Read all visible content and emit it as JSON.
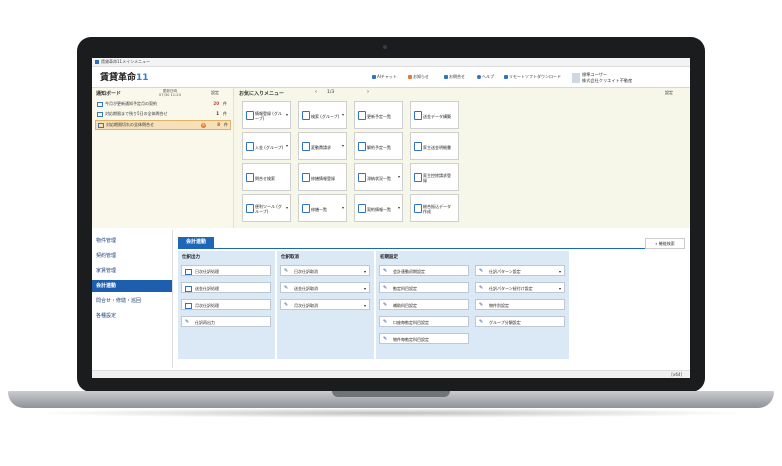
{
  "window": {
    "title": "賃貸革命11メインメニュー"
  },
  "app": {
    "logo_text": "賃貸革命",
    "logo_version": "11"
  },
  "header_buttons": [
    "AIチャット",
    "お知らせ",
    "お問合せ",
    "ヘルプ",
    "リモートソフトダウンロード"
  ],
  "user": {
    "name": "標準ユーザー",
    "company": "株式会社クリエイト不動産"
  },
  "notice_board": {
    "title": "通知ボード",
    "updated_label": "更新日時",
    "updated_time": "07/30 11:24",
    "settings_label": "設定",
    "rows": [
      {
        "label": "今月が更新通知予定月の契約",
        "count": "20",
        "unit": "件"
      },
      {
        "label": "対応期限まで残り5日の全体問合せ",
        "count": "1",
        "unit": "件"
      },
      {
        "label": "対応期限切れの全体問合せ",
        "count": "8",
        "unit": "件",
        "badge": "8"
      }
    ]
  },
  "favorites": {
    "title": "お気に入りメニュー",
    "page": "1/3",
    "settings_label": "設定",
    "tiles": [
      {
        "label": "情報登録 (グループ)",
        "dropdown": true
      },
      {
        "label": "検索 (グループ)",
        "dropdown": true
      },
      {
        "label": "更新予定一覧",
        "dropdown": false
      },
      {
        "label": "送金データ構築",
        "dropdown": false
      },
      {
        "label": "入金 (グループ)",
        "dropdown": true
      },
      {
        "label": "変動費請求",
        "dropdown": true
      },
      {
        "label": "解約予定一覧",
        "dropdown": false
      },
      {
        "label": "家主送金明細書",
        "dropdown": false
      },
      {
        "label": "問合せ検索",
        "dropdown": false
      },
      {
        "label": "修繕情報登録",
        "dropdown": false
      },
      {
        "label": "滞納状況一覧",
        "dropdown": true
      },
      {
        "label": "家主控除請求登録",
        "dropdown": false
      },
      {
        "label": "便利ツール (グループ)",
        "dropdown": true
      },
      {
        "label": "修繕一覧",
        "dropdown": true
      },
      {
        "label": "契約情報一覧",
        "dropdown": true
      },
      {
        "label": "総合振込データ作成",
        "dropdown": false
      }
    ]
  },
  "sidebar": {
    "items": [
      "物件管理",
      "契約管理",
      "家賃管理",
      "会計連動",
      "問合せ・修繕・巡回",
      "各種設定"
    ],
    "active_index": 3
  },
  "main": {
    "tab_label": "会計連動",
    "function_search": "機能検索",
    "panels": [
      {
        "title": "仕訳出力",
        "buttons": [
          {
            "label": "日次仕訳処理",
            "icon": "doc",
            "dropdown": false
          },
          {
            "label": "送金仕訳処理",
            "icon": "doc",
            "dropdown": false
          },
          {
            "label": "月次仕訳処理",
            "icon": "doc",
            "dropdown": false
          },
          {
            "label": "仕訳再出力",
            "icon": "pen",
            "dropdown": false
          }
        ]
      },
      {
        "title": "仕訳取消",
        "buttons": [
          {
            "label": "日次仕訳取消",
            "icon": "pen",
            "dropdown": true
          },
          {
            "label": "送金仕訳取消",
            "icon": "pen",
            "dropdown": true
          },
          {
            "label": "月次仕訳取消",
            "icon": "pen",
            "dropdown": true
          }
        ]
      },
      {
        "title": "初期設定",
        "buttons": [
          {
            "label": "会計連動初期設定",
            "icon": "pen",
            "dropdown": false
          },
          {
            "label": "勘定科目設定",
            "icon": "pen",
            "dropdown": false
          },
          {
            "label": "補助科目設定",
            "icon": "pen",
            "dropdown": false
          },
          {
            "label": "口座毎勘定科目設定",
            "icon": "pen",
            "dropdown": false
          },
          {
            "label": "物件毎勘定科目設定",
            "icon": "pen",
            "dropdown": false
          }
        ],
        "buttons_col2": [
          {
            "label": "仕訳パターン設定",
            "icon": "pen",
            "dropdown": true
          },
          {
            "label": "仕訳パターン紐付け設定",
            "icon": "pen",
            "dropdown": true
          },
          {
            "label": "物件別設定",
            "icon": "pen",
            "dropdown": false
          },
          {
            "label": "グループ分類設定",
            "icon": "pen",
            "dropdown": false
          }
        ]
      }
    ]
  },
  "status_bar": {
    "arch": "[x64]"
  }
}
